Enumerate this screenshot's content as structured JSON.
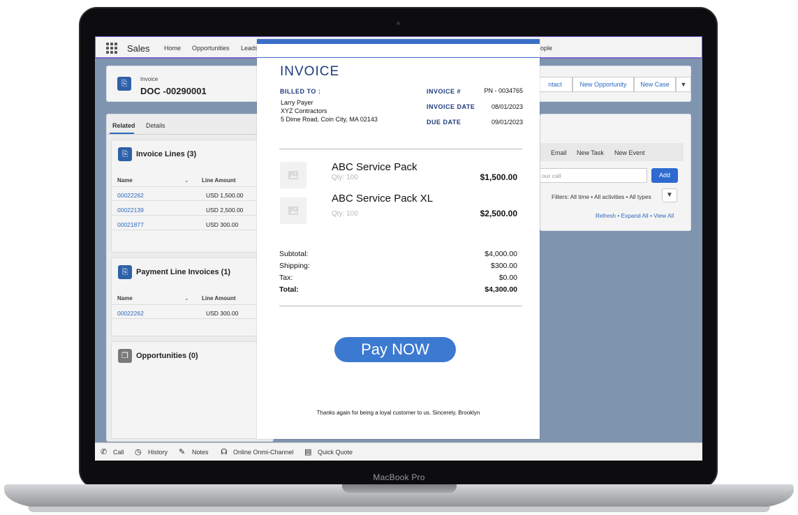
{
  "device": {
    "label": "MacBook Pro"
  },
  "app": {
    "name": "Sales",
    "nav": [
      "Home",
      "Opportunities",
      "Leads",
      "ople"
    ]
  },
  "record": {
    "object_label": "Invoice",
    "name": "DOC -00290001",
    "actions": [
      "ntact",
      "New Opportunity",
      "New Case"
    ]
  },
  "tabs": [
    "Related",
    "Details"
  ],
  "invoice_lines": {
    "title": "Invoice Lines (3)",
    "columns": [
      "Name",
      "Line Amount"
    ],
    "rows": [
      {
        "name": "00022262",
        "amount": "USD 1,500.00"
      },
      {
        "name": "00022139",
        "amount": "USD 2,500.00"
      },
      {
        "name": "00021877",
        "amount": "USD 300.00"
      }
    ]
  },
  "payment_lines": {
    "title": "Payment Line Invoices (1)",
    "columns": [
      "Name",
      "Line Amount"
    ],
    "rows": [
      {
        "name": "00022262",
        "amount": "USD 300.00"
      }
    ]
  },
  "opportunities": {
    "title": "Opportunities (0)"
  },
  "activity": {
    "tabs": [
      "Email",
      "New Task",
      "New Event"
    ],
    "input_placeholder": "our call",
    "add_label": "Add",
    "filters": "Filters: All time • All activities • All types",
    "links": "Refresh • Expand All • View All"
  },
  "dock": [
    "Call",
    "History",
    "Notes",
    "Online Onmi-Channel",
    "Quick Quote"
  ],
  "invoice": {
    "title": "INVOICE",
    "billed_to_label": "BILLED TO :",
    "billed_to": [
      "Larry Payer",
      "XYZ Contractors",
      "5 Dime Road, Coin City, MA 02143"
    ],
    "meta": [
      {
        "label": "INVOICE #",
        "value": "PN - 0034765"
      },
      {
        "label": "INVOICE DATE",
        "value": "08/01/2023"
      },
      {
        "label": "DUE DATE",
        "value": "09/01/2023"
      }
    ],
    "items": [
      {
        "name": "ABC Service Pack",
        "qty": "Qty: 100",
        "price": "$1,500.00"
      },
      {
        "name": "ABC Service Pack XL",
        "qty": "Qty: 100",
        "price": "$2,500.00"
      }
    ],
    "summary": [
      {
        "label": "Subtotal:",
        "value": "$4,000.00"
      },
      {
        "label": "Shipping:",
        "value": "$300.00"
      },
      {
        "label": "Tax:",
        "value": "$0.00"
      },
      {
        "label": "Total:",
        "value": "$4,300.00"
      }
    ],
    "pay_label": "Pay NOW",
    "thanks": "Thanks again for being a loyal customer to us. Sincerely, Brooklyn"
  },
  "colors": {
    "accent": "#3c79d0",
    "invoice_text": "#1f3b7a",
    "screen_bg": "#7f94af"
  }
}
